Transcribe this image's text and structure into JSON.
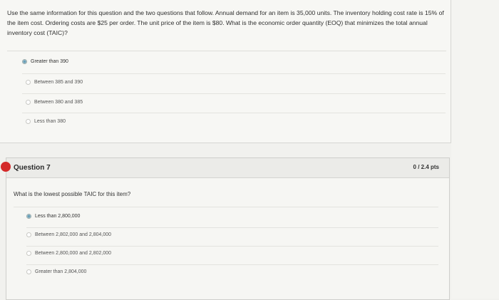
{
  "question6": {
    "text": "Use the same information for this question and the two questions that follow. Annual demand for an item is 35,000 units. The inventory holding cost rate is 15% of the item cost. Ordering costs are $25 per order. The unit price of the item is $80. What is the economic order quantity (EOQ) that minimizes the total annual inventory cost (TAIC)?",
    "options": [
      "Greater than 390",
      "Between 385 and 390",
      "Between 380 and 385",
      "Less than 380"
    ]
  },
  "question7": {
    "title": "Question 7",
    "points": "0 / 2.4 pts",
    "text": "What is the lowest possible TAIC for this item?",
    "options": [
      "Less than 2,800,000",
      "Between 2,802,000 and 2,804,000",
      "Between 2,800,000 and 2,802,000",
      "Greater than 2,804,000"
    ]
  },
  "colors": {
    "flag": "#d42a2a",
    "background": "#f1f1ee"
  }
}
